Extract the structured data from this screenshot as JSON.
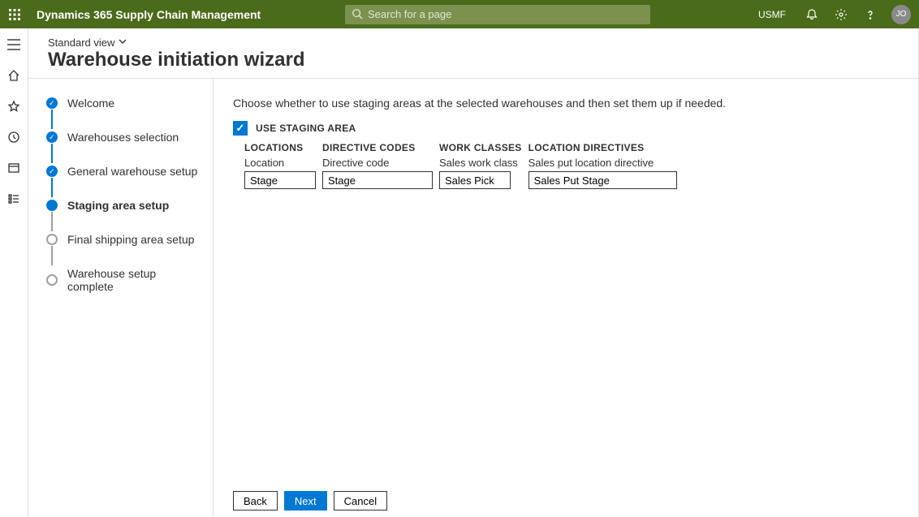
{
  "header": {
    "app_title": "Dynamics 365 Supply Chain Management",
    "search_placeholder": "Search for a page",
    "company": "USMF",
    "avatar_initials": "JO"
  },
  "page": {
    "view_label": "Standard view",
    "title": "Warehouse initiation wizard"
  },
  "steps": [
    {
      "label": "Welcome"
    },
    {
      "label": "Warehouses selection"
    },
    {
      "label": "General warehouse setup"
    },
    {
      "label": "Staging area setup"
    },
    {
      "label": "Final shipping area setup"
    },
    {
      "label": "Warehouse setup complete"
    }
  ],
  "form": {
    "instruction": "Choose whether to use staging areas at the selected warehouses and then set them up if needed.",
    "checkbox_label": "USE STAGING AREA",
    "columns": {
      "locations": {
        "head": "LOCATIONS",
        "field_label": "Location",
        "value": "Stage"
      },
      "directive_codes": {
        "head": "DIRECTIVE CODES",
        "field_label": "Directive code",
        "value": "Stage"
      },
      "work_classes": {
        "head": "WORK CLASSES",
        "field_label": "Sales work class",
        "value": "Sales Pick"
      },
      "location_directives": {
        "head": "LOCATION DIRECTIVES",
        "field_label": "Sales put location directive",
        "value": "Sales Put Stage"
      }
    }
  },
  "buttons": {
    "back": "Back",
    "next": "Next",
    "cancel": "Cancel"
  }
}
